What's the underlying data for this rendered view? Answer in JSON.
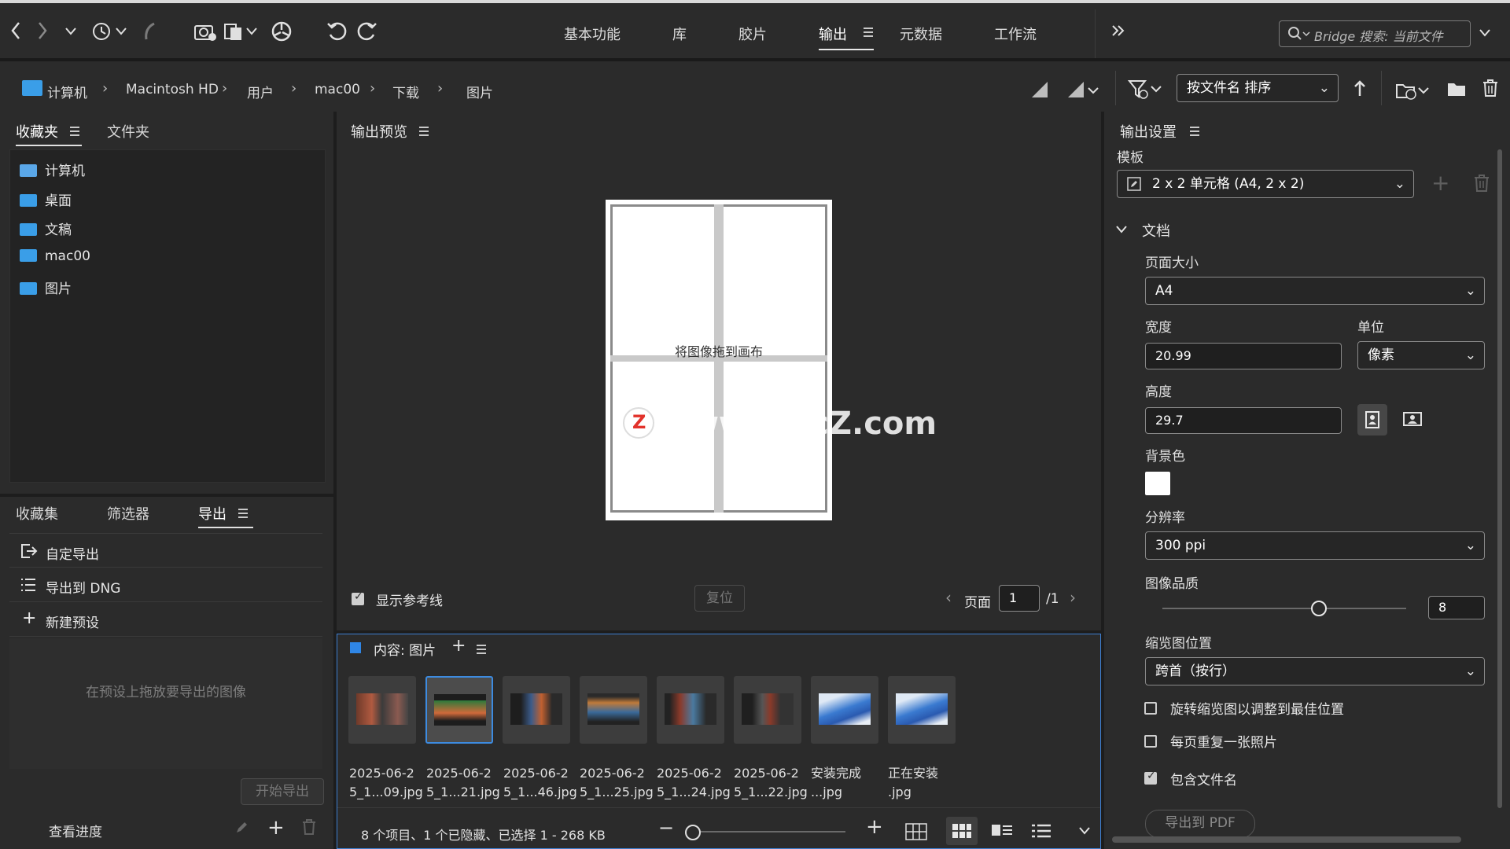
{
  "workspace_tabs": [
    "基本功能",
    "库",
    "胶片",
    "输出",
    "元数据",
    "工作流"
  ],
  "active_workspace": "输出",
  "search": {
    "placeholder": "Bridge 搜索: 当前文件"
  },
  "breadcrumb": [
    "计算机",
    "Macintosh HD",
    "用户",
    "mac00",
    "下载",
    "图片"
  ],
  "sort_label": "按文件名 排序",
  "left_panel": {
    "tabs": [
      "收藏夹",
      "文件夹"
    ],
    "favorites": [
      "计算机",
      "桌面",
      "文稿",
      "mac00",
      "图片"
    ],
    "bottom_tabs": [
      "收藏集",
      "筛选器",
      "导出"
    ],
    "export_items": [
      "自定导出",
      "导出到 DNG",
      "新建预设"
    ],
    "drop_hint": "在预设上拖放要导出的图像",
    "start_export": "开始导出",
    "view_progress": "查看进度"
  },
  "preview": {
    "title": "输出预览",
    "drop_text": "将图像拖到画布",
    "show_guides": "显示参考线",
    "show_guides_checked": true,
    "reset": "复位",
    "page_label": "页面",
    "page_value": "1",
    "page_total": "/1",
    "watermark": "www.MacZ.com"
  },
  "content": {
    "title": "内容: 图片",
    "thumbnails": [
      {
        "line1": "2025-06-2",
        "line2": "5_1...09.jpg",
        "selected": false
      },
      {
        "line1": "2025-06-2",
        "line2": "5_1...21.jpg",
        "selected": true
      },
      {
        "line1": "2025-06-2",
        "line2": "5_1...46.jpg",
        "selected": false
      },
      {
        "line1": "2025-06-2",
        "line2": "5_1...25.jpg",
        "selected": false
      },
      {
        "line1": "2025-06-2",
        "line2": "5_1...24.jpg",
        "selected": false
      },
      {
        "line1": "2025-06-2",
        "line2": "5_1...22.jpg",
        "selected": false
      },
      {
        "line1": "安装完成",
        "line2": "...jpg",
        "selected": false
      },
      {
        "line1": "正在安装",
        "line2": ".jpg",
        "selected": false
      }
    ],
    "status": "8 个项目、1 个已隐藏、已选择 1 - 268 KB"
  },
  "output_settings": {
    "title": "输出设置",
    "template_label": "模板",
    "template_value": "2 x 2 单元格 (A4, 2 x 2)",
    "section": "文档",
    "page_size_label": "页面大小",
    "page_size_value": "A4",
    "width_label": "宽度",
    "width_value": "20.99",
    "unit_label": "单位",
    "unit_value": "像素",
    "height_label": "高度",
    "height_value": "29.7",
    "bg_label": "背景色",
    "bg_color": "#ffffff",
    "resolution_label": "分辨率",
    "resolution_value": "300 ppi",
    "quality_label": "图像品质",
    "quality_value": "8",
    "quality_fraction": 0.64,
    "thumb_pos_label": "缩览图位置",
    "thumb_pos_value": "跨首（按行）",
    "options": [
      {
        "label": "旋转缩览图以调整到最佳位置",
        "checked": false
      },
      {
        "label": "每页重复一张照片",
        "checked": false
      },
      {
        "label": "包含文件名",
        "checked": true
      }
    ],
    "export_pdf": "导出到 PDF"
  }
}
